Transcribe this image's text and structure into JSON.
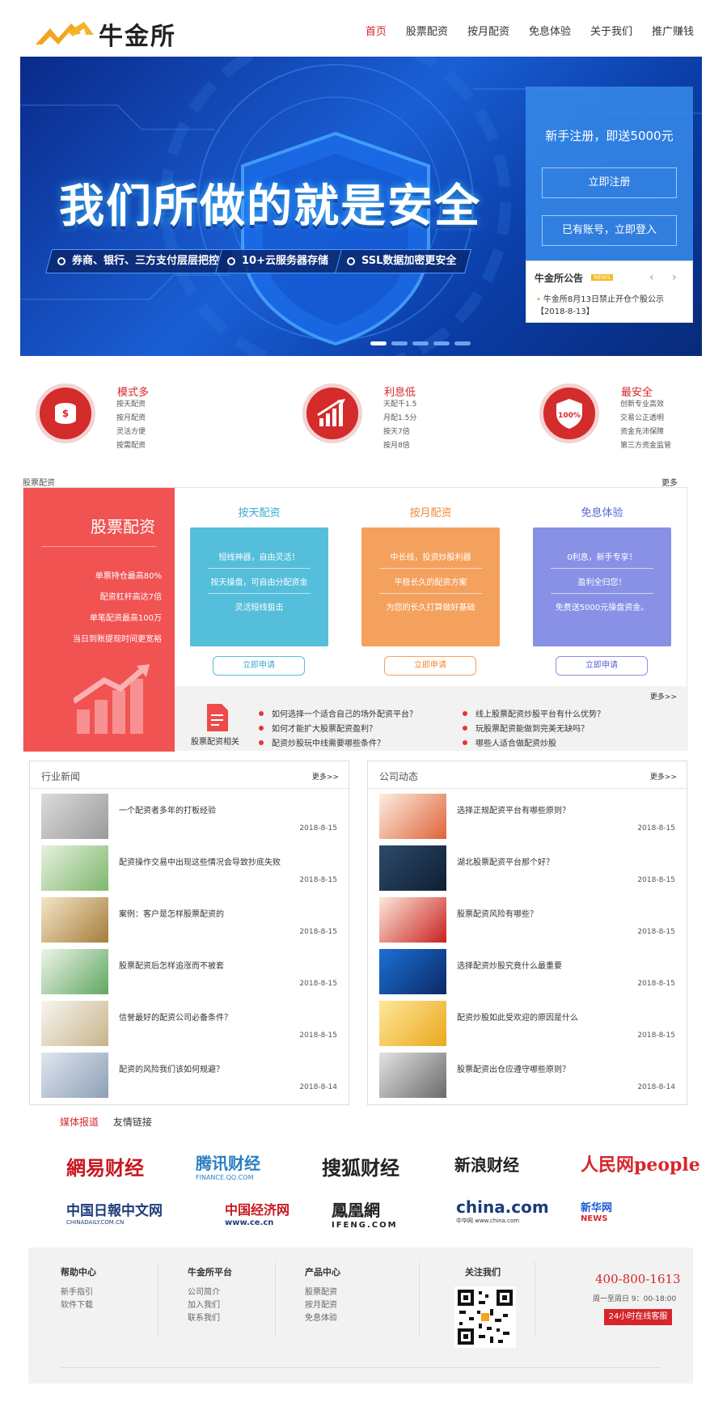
{
  "header": {
    "logo_text": "牛金所",
    "nav": [
      "首页",
      "股票配资",
      "按月配资",
      "免息体验",
      "关于我们",
      "推广赚钱"
    ]
  },
  "banner": {
    "title": "我们所做的就是安全",
    "features": [
      "券商、银行、三方支付层层把控",
      "10+云服务器存储",
      "SSL数据加密更安全"
    ],
    "register": {
      "title": "新手注册，即送5000元",
      "register_btn": "立即注册",
      "login_btn": "已有账号，立即登入"
    },
    "notice": {
      "title": "牛金所公告",
      "tag": "NEWS",
      "item": "牛金所8月13日禁止开仓个股公示",
      "date": "【2018-8-13】"
    }
  },
  "features": [
    {
      "title": "模式多",
      "lines": [
        "按天配资",
        "按月配资",
        "灵活方便",
        "按需配资"
      ]
    },
    {
      "title": "利息低",
      "lines": [
        "天配千1.5",
        "月配1.5分",
        "按天7倍",
        "按月8倍"
      ]
    },
    {
      "title": "最安全",
      "lines": [
        "创新专业高效",
        "交易公正透明",
        "资金充沛保障",
        "第三方资金监管"
      ]
    }
  ],
  "stock_section": {
    "label": "股票配资",
    "more": "更多",
    "red_panel": {
      "title": "股票配资",
      "items": [
        "单票持仓最高80%",
        "配资杠杆高达7倍",
        "单笔配资最高100万",
        "当日到账提现时间更宽裕"
      ]
    },
    "columns": [
      {
        "title": "按天配资",
        "lines": [
          "短线神器，自由灵活！",
          "按天操盘，可自由分配资金",
          "灵活短线狙击"
        ],
        "btn": "立即申请",
        "color": "#55bedb"
      },
      {
        "title": "按月配资",
        "lines": [
          "中长线，投资炒股利器",
          "平稳长久的配资方案",
          "为您的长久打算做好基础"
        ],
        "btn": "立即申请",
        "color": "#f5a15e"
      },
      {
        "title": "免息体验",
        "lines": [
          "0利息，新手专享！",
          "盈利全归您！",
          "免费送5000元操盘资金。"
        ],
        "btn": "立即申请",
        "color": "#8891e6"
      }
    ],
    "related": {
      "label": "股票配资相关",
      "more": "更多>>",
      "questions": [
        "如何选择一个适合自己的场外配资平台？",
        "线上股票配资炒股平台有什么优势？",
        "如何才能扩大股票配资盈利？",
        "玩股票配资能做到完美无缺吗？",
        "配资炒股玩中线需要哪些条件？",
        "哪些人适合做配资炒股"
      ]
    }
  },
  "industry_news": {
    "title": "行业新闻",
    "more": "更多>>",
    "items": [
      {
        "title": "一个配资者多年的打板经验",
        "date": "2018-8-15"
      },
      {
        "title": "配资操作交易中出现这些情况会导致抄底失败",
        "date": "2018-8-15"
      },
      {
        "title": "案例：客户是怎样股票配资的",
        "date": "2018-8-15"
      },
      {
        "title": "股票配资后怎样追涨而不被套",
        "date": "2018-8-15"
      },
      {
        "title": "信誉最好的配资公司必备条件？",
        "date": "2018-8-15"
      },
      {
        "title": "配资的风险我们该如何规避？",
        "date": "2018-8-14"
      }
    ]
  },
  "company_news": {
    "title": "公司动态",
    "more": "更多>>",
    "items": [
      {
        "title": "选择正规配资平台有哪些原则？",
        "date": "2018-8-15"
      },
      {
        "title": "湖北股票配资平台那个好？",
        "date": "2018-8-15"
      },
      {
        "title": "股票配资风险有哪些？",
        "date": "2018-8-15"
      },
      {
        "title": "选择配资炒股究竟什么最重要",
        "date": "2018-8-15"
      },
      {
        "title": "配资炒股如此受欢迎的原因是什么",
        "date": "2018-8-15"
      },
      {
        "title": "股票配资出仓应遵守哪些原则？",
        "date": "2018-8-14"
      }
    ]
  },
  "media": {
    "tabs": [
      "媒体报道",
      "友情链接"
    ],
    "logos": [
      "網易财经",
      "腾讯财经",
      "搜狐财经",
      "新浪财经",
      "人民网people",
      "中国日報中文网",
      "中国经济网",
      "鳳凰網",
      "china.com",
      "新华网"
    ],
    "logo_subs": [
      "FINANCE.QQ.COM",
      "www.ce.cn",
      "IFENG.COM",
      "中华网 www.china.com",
      "CHINADAILY.COM.CN",
      "NEWS"
    ]
  },
  "footer": {
    "help": {
      "title": "帮助中心",
      "links": [
        "新手指引",
        "软件下载"
      ]
    },
    "platform": {
      "title": "牛金所平台",
      "links": [
        "公司简介",
        "加入我们",
        "联系我们"
      ]
    },
    "products": {
      "title": "产品中心",
      "links": [
        "股票配资",
        "按月配资",
        "免息体验"
      ]
    },
    "follow": {
      "title": "关注我们"
    },
    "phone": "400-800-1613",
    "hours": "周一至周日 9：00-18:00",
    "service": "24小时在线客服"
  }
}
